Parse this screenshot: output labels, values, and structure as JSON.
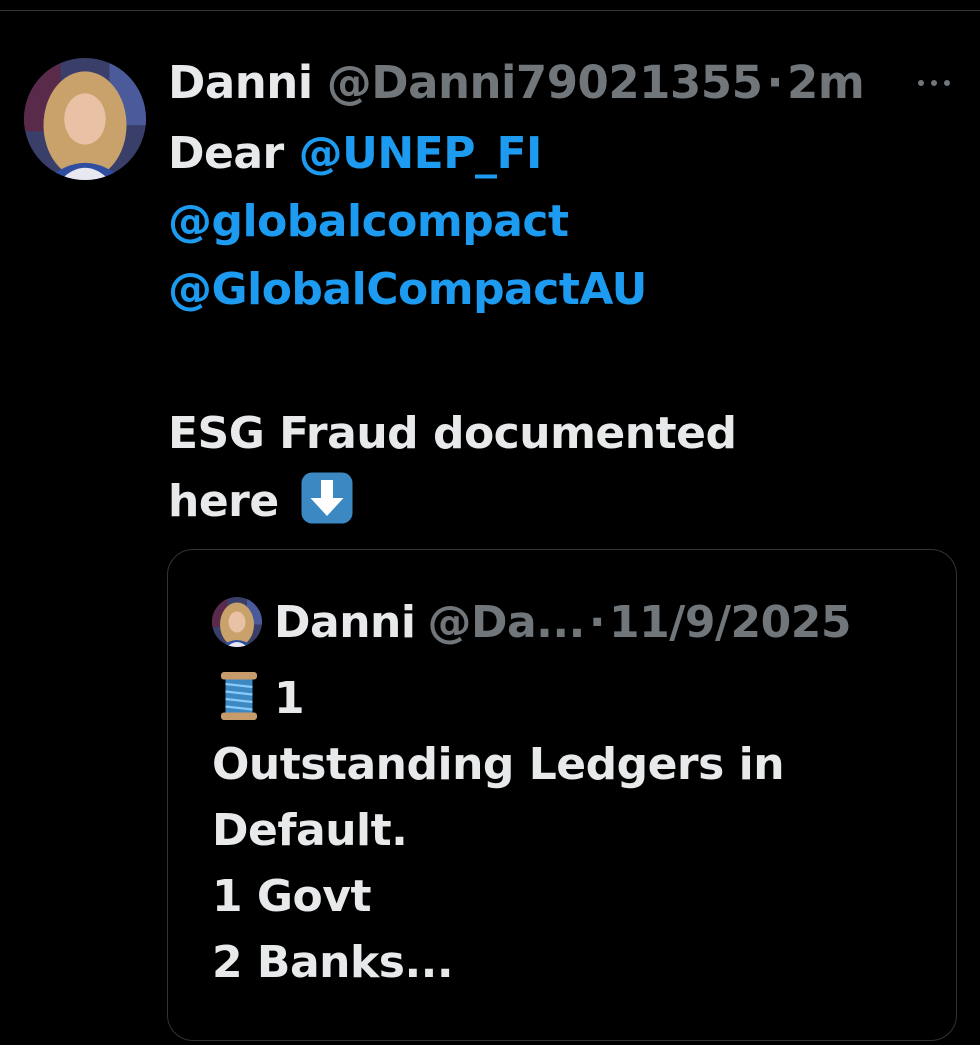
{
  "tweet": {
    "display_name": "Danni",
    "handle": "@Danni79021355",
    "separator": "·",
    "time": "2m",
    "body": {
      "greeting": "Dear",
      "mentions": [
        "@UNEP_FI",
        "@globalcompact",
        "@GlobalCompactAU"
      ],
      "line_1": "ESG Fraud documented",
      "line_2": "here",
      "emoji": "down-arrow-icon"
    }
  },
  "quoted_tweet": {
    "display_name": "Danni",
    "handle": "@Da...",
    "separator": "·",
    "date": "11/9/2025",
    "thread_emoji": "spool-of-thread-icon",
    "thread_number": "1",
    "lines": [
      "Outstanding Ledgers in",
      "Default.",
      "1 Govt",
      "2 Banks..."
    ]
  },
  "colors": {
    "background": "#000000",
    "text_primary": "#e7e9ea",
    "text_secondary": "#71767b",
    "mention": "#1d9bf0",
    "border": "#2f3336"
  }
}
